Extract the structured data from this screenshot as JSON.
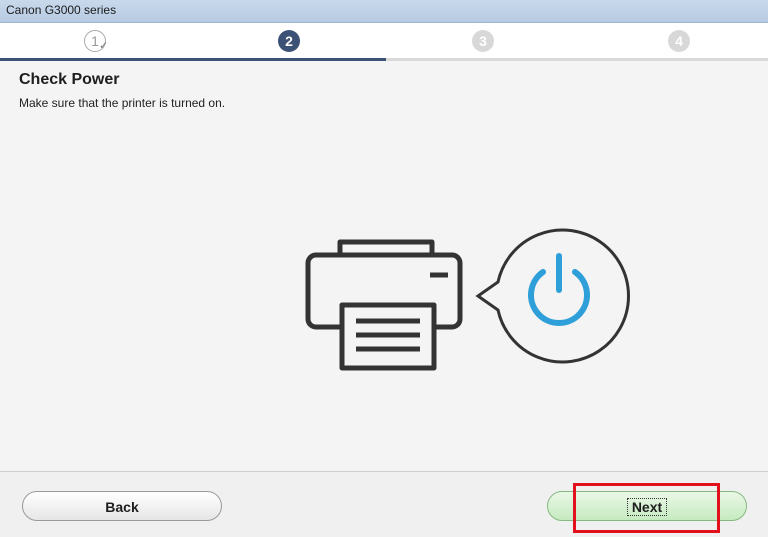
{
  "window": {
    "title": "Canon G3000 series"
  },
  "steps": [
    {
      "label": "1",
      "state": "done"
    },
    {
      "label": "2",
      "state": "active"
    },
    {
      "label": "3",
      "state": "pending"
    },
    {
      "label": "4",
      "state": "pending"
    }
  ],
  "page": {
    "heading": "Check Power",
    "instruction": "Make sure that the printer is turned on."
  },
  "illustration": {
    "printer_icon": "printer-icon",
    "power_icon": "power-icon",
    "power_color": "#2e9fd9"
  },
  "footer": {
    "back_label": "Back",
    "next_label": "Next"
  },
  "colors": {
    "active_step": "#3b5176",
    "highlight": "#e3101d"
  }
}
